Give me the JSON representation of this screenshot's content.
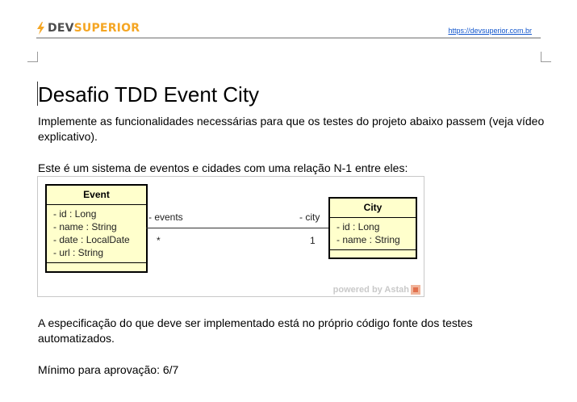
{
  "header": {
    "logo_dev": "DEV",
    "logo_superior": "SUPERIOR",
    "url": "https://devsuperior.com.br",
    "logo_icon": "lightning-bolt-icon",
    "brand_orange": "#f5a623"
  },
  "document": {
    "title": "Desafio TDD Event City",
    "paragraph1": "Implemente as funcionalidades necessárias para que os testes do projeto abaixo passem (veja vídeo explicativo).",
    "paragraph2": "Este é um sistema de eventos e cidades com uma relação N-1 entre eles:",
    "paragraph3": "A especificação do que deve ser implementado está no próprio código fonte dos testes automatizados.",
    "paragraph4": "Mínimo para aprovação: 6/7"
  },
  "diagram": {
    "event": {
      "name": "Event",
      "attributes": [
        "- id : Long",
        "- name : String",
        "- date : LocalDate",
        "- url : String"
      ]
    },
    "city": {
      "name": "City",
      "attributes": [
        "- id : Long",
        "- name : String"
      ]
    },
    "association": {
      "event_role": "- events",
      "city_role": "- city",
      "event_multiplicity": "*",
      "city_multiplicity": "1"
    },
    "watermark": "powered by Astah",
    "class_fill": "#ffffcc"
  }
}
